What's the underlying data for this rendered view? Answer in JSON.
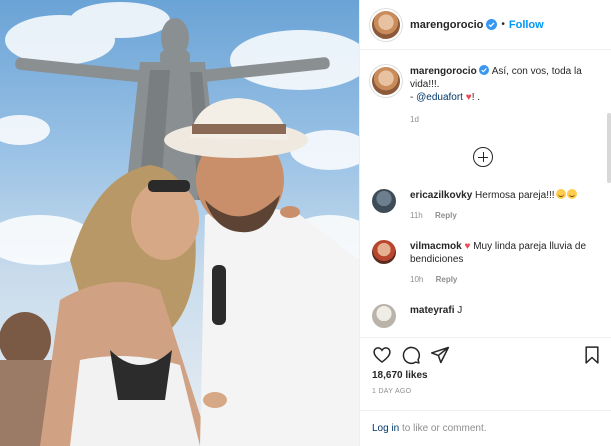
{
  "post": {
    "author": {
      "username": "marengorocio",
      "verified": true,
      "follow_label": "Follow",
      "separator": "•"
    },
    "caption": {
      "username": "marengorocio",
      "text": "Así, con vos, toda la vida!!!.",
      "mention_prefix": "- ",
      "mention": "@eduafort",
      "heart": "♥",
      "suffix": "! .",
      "time": "1d"
    },
    "load_more_icon": "plus-circle-icon",
    "comments": [
      {
        "username": "ericazilkovky",
        "text": "Hermosa pareja!!!",
        "emoji_count": 2,
        "time": "11h",
        "reply_label": "Reply"
      },
      {
        "username": "vilmacmok",
        "heart": "♥",
        "text": "Muy linda pareja lluvia de bendiciones",
        "time": "10h",
        "reply_label": "Reply"
      },
      {
        "username": "mateyrafi",
        "text": "J",
        "time": "",
        "reply_label": ""
      }
    ],
    "actions": {
      "like_icon": "heart-icon",
      "comment_icon": "comment-icon",
      "share_icon": "share-icon",
      "save_icon": "bookmark-icon"
    },
    "likes": "18,670 likes",
    "date": "1 DAY AGO",
    "login_prompt": {
      "link": "Log in",
      "text": " to like or comment."
    }
  },
  "colors": {
    "accent": "#0095f6",
    "mention": "#00376b",
    "heart": "#ed4956",
    "muted": "#8e8e8e",
    "text": "#262626"
  }
}
